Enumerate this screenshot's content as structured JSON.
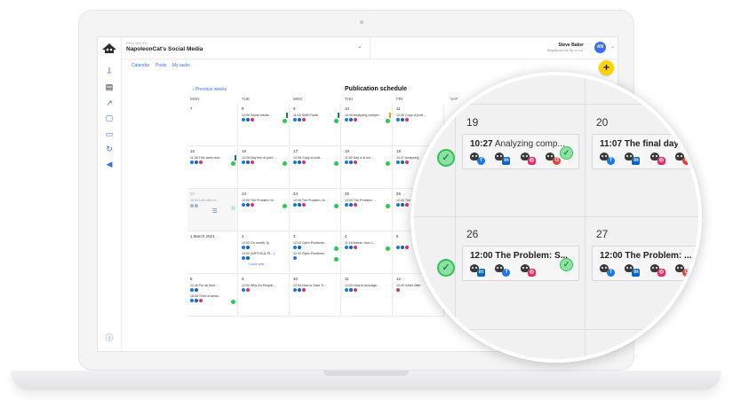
{
  "app": {
    "project_label": "PROJECTS",
    "project_name": "NapoleonCat's Social Media",
    "user_name": "Steve Baker",
    "user_org": "NapoleonCat Sp. z o.o.",
    "avatar_initials": "AN"
  },
  "tabs": [
    "Calendar",
    "Posts",
    "My tasks"
  ],
  "calendar": {
    "prev_label": "Previous weeks",
    "title": "Publication schedule",
    "day_headers": [
      "MON",
      "TUE",
      "WED",
      "THU",
      "FRI",
      "SAT"
    ],
    "weeks": [
      [
        "7",
        "8",
        "9",
        "10",
        "11",
        "12"
      ],
      [
        "15",
        "16",
        "17",
        "18",
        "19",
        "20"
      ],
      [
        "22",
        "23",
        "24",
        "25",
        "26",
        "27"
      ],
      [
        "1 March 2021",
        "2",
        "3",
        "4",
        "5",
        "6"
      ],
      [
        "8",
        "9",
        "10",
        "11",
        "12",
        "13"
      ]
    ],
    "posts": {
      "w1_tue": "13:06 Social media ...",
      "w1_wed": "11:16 SMB Posts",
      "w1_thu": "10:40 Analyzing compet...",
      "w1_fri": "12:30 Copy of post ...",
      "w2_mon": "11:38 This week and...",
      "w2_tue": "12:26 Day two of post...",
      "w2_wed": "12:08 Copy of post...",
      "w2_thu": "11:52 Day 4 of our ...",
      "w2_fri": "10:27 Analyzing",
      "w3_mon": "12:00 Let's dive in...",
      "w3_tue": "12:00 The Problem: M...",
      "w3_wed": "12:00 The Problem: M...",
      "w3_thu": "12:00 The Problem: ...",
      "w3_fri": "12:00 The",
      "w4_tue_a": "14:02 On credit), fy...",
      "w4_tue_b": "14:02 (ARTYKUŁ PL...)",
      "w4_tue_more": "1 more post",
      "w4_wed_a": "12:02 Open Positions...",
      "w4_wed_b": "12:02 Open Positions...",
      "w4_thu": "11:16 Article: How t...",
      "w5_mon_a": "12:40 For all their...",
      "w5_mon_b": "18:08 Third of answ...",
      "w5_tue": "12:00 Why Do People...",
      "w5_wed": "12:00 How to Save Ti...",
      "w5_thu": "12:00 How to leverage...",
      "w5_fri": "12:00 SAMI Offer"
    }
  },
  "magnifier": {
    "days": [
      "19",
      "20",
      "26",
      "27"
    ],
    "cards": [
      {
        "time": "10:27",
        "title": "Analyzing comp..."
      },
      {
        "time": "11:07",
        "title": "The final day"
      },
      {
        "time": "12:00",
        "title": "The Problem: S..."
      },
      {
        "time": "12:00",
        "title": "The Problem: ..."
      }
    ]
  },
  "colors": {
    "accent": "#3b6ef5",
    "add_button": "#ffd400",
    "success": "#31c45a"
  }
}
